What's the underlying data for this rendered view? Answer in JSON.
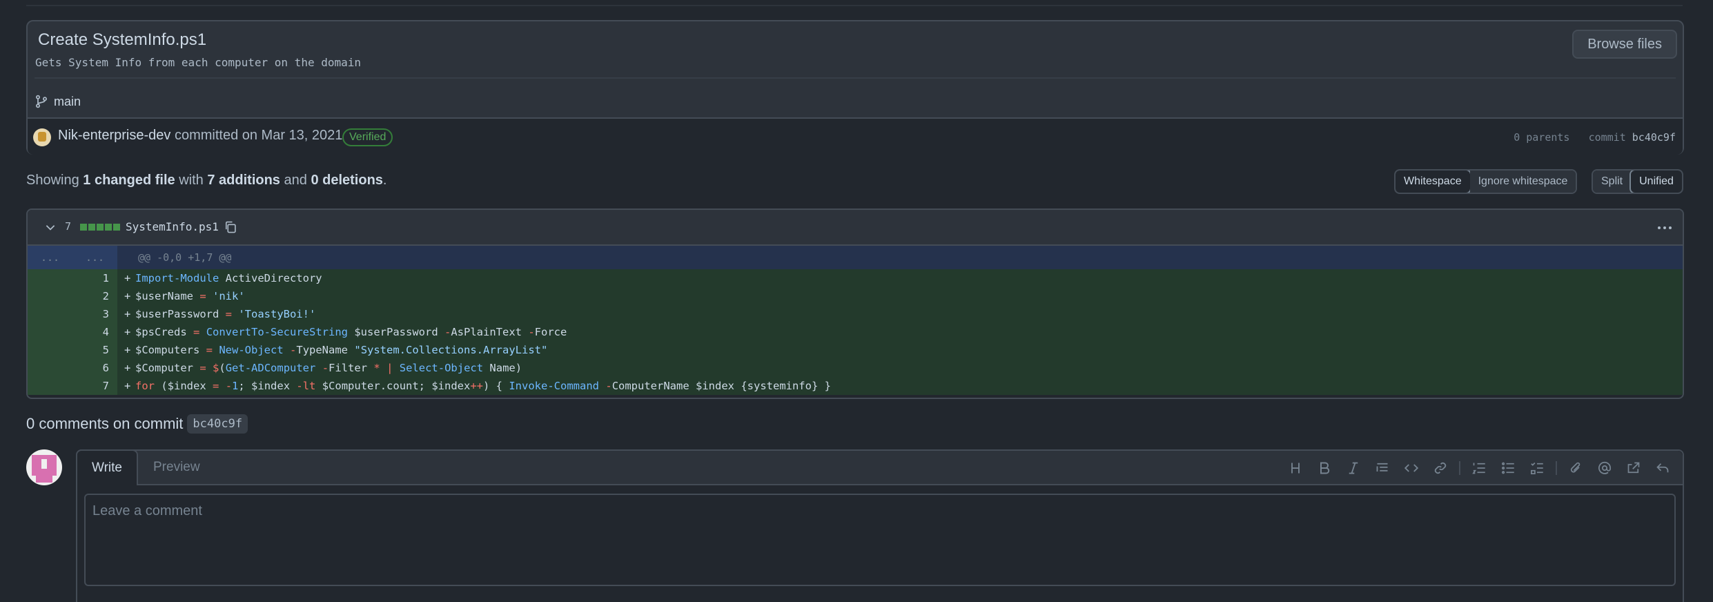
{
  "commit": {
    "title": "Create SystemInfo.ps1",
    "description": "Gets System Info from each computer on the domain",
    "browse_label": "Browse files",
    "branch": "main",
    "author": "Nik-enterprise-dev",
    "committed_text": "committed on Mar 13, 2021",
    "verified_label": "Verified",
    "parents_text": "0 parents",
    "commit_label": "commit",
    "sha": "bc40c9f"
  },
  "summary": {
    "prefix": "Showing",
    "files": "1 changed file",
    "with": "with",
    "additions": "7 additions",
    "and": "and",
    "deletions": "0 deletions",
    "suffix": "."
  },
  "view_controls": {
    "whitespace": "Whitespace",
    "ignore_whitespace": "Ignore whitespace",
    "split": "Split",
    "unified": "Unified",
    "selected": "Unified"
  },
  "diff": {
    "changes": "7",
    "filename": "SystemInfo.ps1",
    "hunk_header": "@@ -0,0 +1,7 @@",
    "expand_left": "...",
    "expand_right": "...",
    "lines": [
      {
        "n": "1",
        "code": "Import-Module ActiveDirectory"
      },
      {
        "n": "2",
        "code": "$userName = 'nik'"
      },
      {
        "n": "3",
        "code": "$userPassword = 'ToastyBoi!'"
      },
      {
        "n": "4",
        "code": "$psCreds = ConvertTo-SecureString $userPassword -AsPlainText -Force"
      },
      {
        "n": "5",
        "code": "$Computers = New-Object -TypeName \"System.Collections.ArrayList\""
      },
      {
        "n": "6",
        "code": "$Computer = $(Get-ADComputer -Filter * | Select-Object Name)"
      },
      {
        "n": "7",
        "code": "for ($index = -1; $index -lt $Computer.count; $index++) { Invoke-Command -ComputerName $index {systeminfo} }"
      }
    ]
  },
  "comments": {
    "title": "0 comments on commit",
    "sha": "bc40c9f",
    "tab_write": "Write",
    "tab_preview": "Preview",
    "placeholder": "Leave a comment"
  },
  "toolbar_icons": [
    "heading-icon",
    "bold-icon",
    "italic-icon",
    "quote-icon",
    "code-icon",
    "link-icon",
    "ordered-list-icon",
    "unordered-list-icon",
    "task-list-icon",
    "attach-icon",
    "mention-icon",
    "reference-icon",
    "reply-icon"
  ],
  "colors": {
    "bg": "#22272e",
    "addition": "#46954a",
    "verified": "#57ab5a",
    "link": "#6cb6ff"
  }
}
